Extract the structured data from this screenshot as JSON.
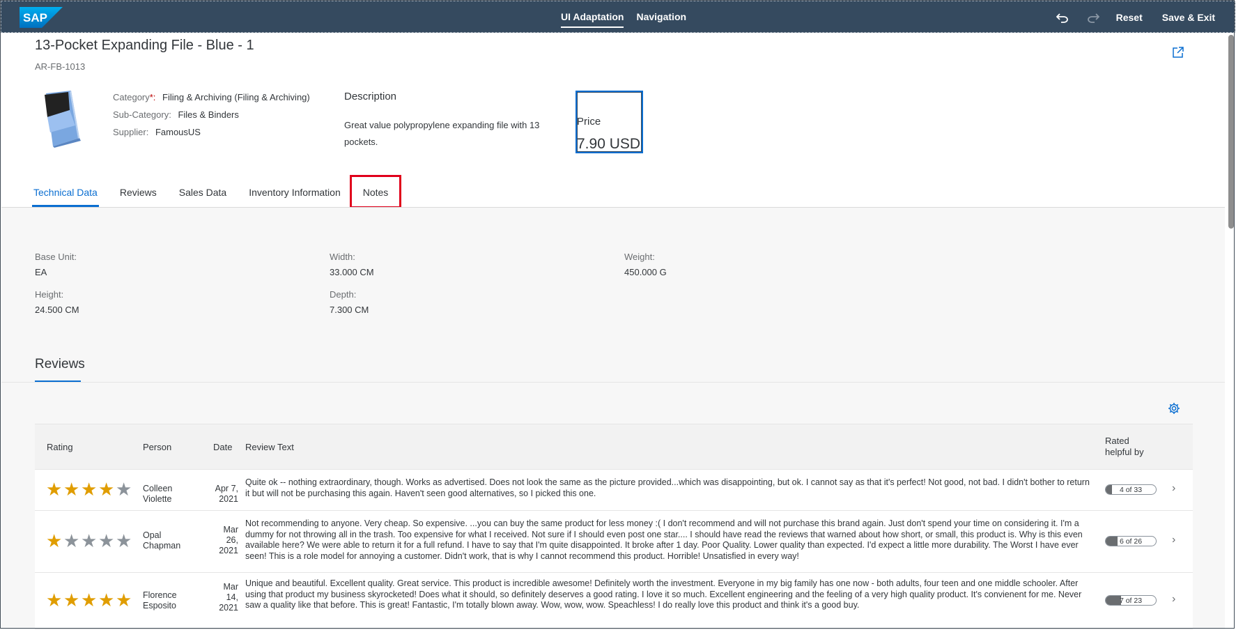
{
  "shell": {
    "logo_text": "SAP",
    "tabs": [
      {
        "label": "UI Adaptation",
        "active": true
      },
      {
        "label": "Navigation",
        "active": false
      }
    ],
    "undo_icon": "undo-icon",
    "redo_icon": "redo-icon",
    "reset_label": "Reset",
    "save_exit_label": "Save & Exit"
  },
  "header": {
    "title": "13-Pocket Expanding File - Blue - 1",
    "product_id": "AR-FB-1013",
    "category_label": "Category",
    "category_required": "*:",
    "category_value": "Filing & Archiving (Filing & Archiving)",
    "subcategory_label": "Sub-Category:",
    "subcategory_value": "Files & Binders",
    "supplier_label": "Supplier:",
    "supplier_value": "FamousUS",
    "description_title": "Description",
    "description_text": "Great value polypropylene expanding file with 13 pockets.",
    "price_label": "Price",
    "price_value": "7.90  USD"
  },
  "tabs": [
    "Technical Data",
    "Reviews",
    "Sales Data",
    "Inventory Information",
    "Notes"
  ],
  "technical": {
    "base_unit_label": "Base Unit:",
    "base_unit": "EA",
    "width_label": "Width:",
    "width": "33.000 CM",
    "weight_label": "Weight:",
    "weight": "450.000 G",
    "height_label": "Height:",
    "height": "24.500 CM",
    "depth_label": "Depth:",
    "depth": "7.300 CM"
  },
  "reviews": {
    "section_title": "Reviews",
    "columns": {
      "rating": "Rating",
      "person": "Person",
      "date": "Date",
      "text": "Review Text",
      "helpful": "Rated helpful by"
    },
    "rows": [
      {
        "rating": 4,
        "person": "Colleen Violette",
        "date": "Apr 7, 2021",
        "text": "Quite ok -- nothing extraordinary, though. Works as advertised. Does not look the same as the picture provided...which was disappointing, but ok. I cannot say as that it's perfect! Not good, not bad. I didn't bother to return it but will not be purchasing this again. Haven't seen good alternatives, so I picked this one.",
        "helpful": "4 of 33",
        "helpful_fraction": 0.12
      },
      {
        "rating": 1,
        "person": "Opal Chapman",
        "date": "Mar 26, 2021",
        "text": "Not recommending to anyone. Very cheap. So expensive. ...you can buy the same product for less money :( I don't recommend and will not purchase this brand again. Just don't spend your time on considering it. I'm a dummy for not throwing all in the trash. Too expensive for what I received. Not sure if I should even post one star.... I should have read the reviews that warned about how short, or small, this product is. Why is this even available here? We were able to return it for a full refund. I have to say that I'm quite disappointed. It broke after 1 day. Poor Quality. Lower quality than expected. I'd expect a little more durability. The Worst I have ever seen! This is a role model for annoying a customer. Didn't work, that is why I cannot recommend this product. Horrible! Unsatisfied in every way!",
        "helpful": "6 of 26",
        "helpful_fraction": 0.23
      },
      {
        "rating": 5,
        "person": "Florence Esposito",
        "date": "Mar 14, 2021",
        "text": "Unique and beautiful. Excellent quality. Great service. This product is incredible awesome! Definitely worth the investment. Everyone in my big family has one now - both adults, four teen and one middle schooler. After using that product my business skyrocketed! Does what it should, so definitely deserves a good rating. I love it so much. Excellent engineering and the feeling of a very high quality product. It's convienent for me. Never saw a quality like that before. This is great! Fantastic, I'm totally blown away. Wow, wow, wow. Speachless! I do really love this product and think it's a good buy.",
        "helpful": "7 of 23",
        "helpful_fraction": 0.3
      }
    ]
  },
  "colors": {
    "shell_bg": "#354a5f",
    "accent": "#0a6ed1",
    "star": "#e09d00",
    "highlight": "#e0001b"
  }
}
